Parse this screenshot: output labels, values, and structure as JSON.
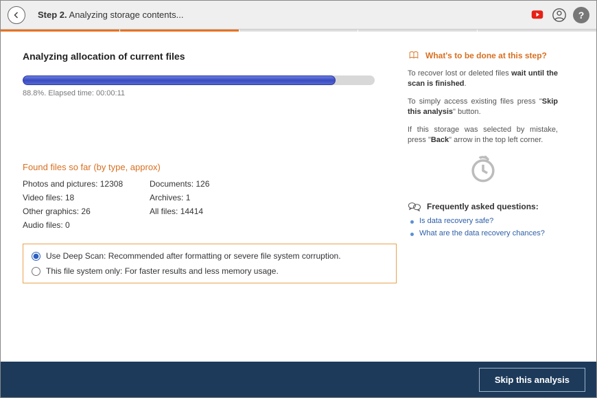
{
  "header": {
    "step_prefix": "Step 2.",
    "step_text": "Analyzing storage contents..."
  },
  "progress_steps": {
    "active": 2,
    "total": 5
  },
  "main": {
    "title": "Analyzing allocation of current files",
    "progress_pct": 88.8,
    "progress_text": "88.8%. Elapsed time: 00:00:11",
    "found_title": "Found files so far (by type, approx)",
    "stats_left": [
      {
        "label": "Photos and pictures:",
        "value": "12308"
      },
      {
        "label": "Video files:",
        "value": "18"
      },
      {
        "label": "Other graphics:",
        "value": "26"
      },
      {
        "label": "Audio files:",
        "value": "0"
      }
    ],
    "stats_right": [
      {
        "label": "Documents:",
        "value": "126"
      },
      {
        "label": "Archives:",
        "value": "1"
      },
      {
        "label": "All files:",
        "value": "14414"
      }
    ],
    "option_deep_label": "Use Deep Scan:",
    "option_deep_desc": "Recommended after formatting or severe file system corruption.",
    "option_fast_label": "This file system only:",
    "option_fast_desc": "For faster results and less memory usage.",
    "selected_option": "deep"
  },
  "side": {
    "title": "What's to be done at this step?",
    "p1_a": "To recover lost or deleted files ",
    "p1_b": "wait until the scan is finished",
    "p1_c": ".",
    "p2_a": "To simply access existing files press \"",
    "p2_b": "Skip this analysis",
    "p2_c": "\" button.",
    "p3_a": "If this storage was selected by mistake, press \"",
    "p3_b": "Back",
    "p3_c": "\" arrow in the top left corner.",
    "faq_title": "Frequently asked questions:",
    "faq": [
      "Is data recovery safe?",
      "What are the data recovery chances?"
    ]
  },
  "footer": {
    "skip_label": "Skip this analysis"
  }
}
